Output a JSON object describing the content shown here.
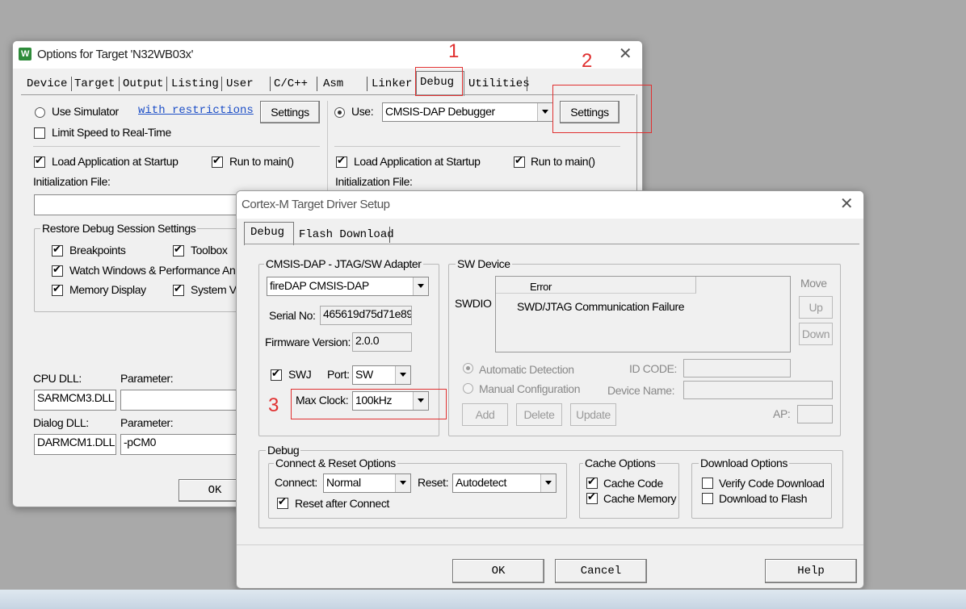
{
  "options_window": {
    "title": "Options for Target 'N32WB03x'",
    "tabs": [
      "Device",
      "Target",
      "Output",
      "Listing",
      "User",
      "C/C++",
      "Asm",
      "Linker",
      "Debug",
      "Utilities"
    ],
    "active_tab": "Debug",
    "use_simulator_label": "Use Simulator",
    "with_restrictions_link": "with restrictions",
    "settings_label": "Settings",
    "limit_speed_label": "Limit Speed to Real-Time",
    "use_label": "Use:",
    "debugger_value": "CMSIS-DAP Debugger",
    "load_app_label": "Load Application at Startup",
    "run_to_main_label": "Run to main()",
    "init_file_label": "Initialization File:",
    "restore_group_title": "Restore Debug Session Settings",
    "breakpoints_label": "Breakpoints",
    "toolbox_label": "Toolbox",
    "watch_windows_label": "Watch Windows & Performance An",
    "memory_display_label": "Memory Display",
    "system_viewer_label": "System Vi",
    "cpu_dll_label": "CPU DLL:",
    "parameter_label": "Parameter:",
    "cpu_dll_value": "SARMCM3.DLL",
    "dialog_dll_label": "Dialog DLL:",
    "dialog_dll_value": "DARMCM1.DLL",
    "dialog_param_value": "-pCM0",
    "ok_label": "OK"
  },
  "driver_window": {
    "title": "Cortex-M Target Driver Setup",
    "tabs": [
      "Debug",
      "Flash Download"
    ],
    "adapter_group_title": "CMSIS-DAP - JTAG/SW Adapter",
    "adapter_value": "fireDAP CMSIS-DAP",
    "serial_label": "Serial No:",
    "serial_value": "465619d75d71e89",
    "firmware_label": "Firmware Version:",
    "firmware_value": "2.0.0",
    "swj_label": "SWJ",
    "port_label": "Port:",
    "port_value": "SW",
    "max_clock_label": "Max Clock:",
    "max_clock_value": "100kHz",
    "sw_device_group_title": "SW Device",
    "swdio_label": "SWDIO",
    "table_header": "Error",
    "table_row": "SWD/JTAG Communication Failure",
    "move_label": "Move",
    "up_label": "Up",
    "down_label": "Down",
    "auto_detect_label": "Automatic Detection",
    "manual_config_label": "Manual Configuration",
    "id_code_label": "ID CODE:",
    "device_name_label": "Device Name:",
    "add_label": "Add",
    "delete_label": "Delete",
    "update_label": "Update",
    "ap_label": "AP:",
    "debug_group_title": "Debug",
    "connect_reset_title": "Connect & Reset Options",
    "connect_label": "Connect:",
    "connect_value": "Normal",
    "reset_label": "Reset:",
    "reset_value": "Autodetect",
    "reset_after_connect_label": "Reset after Connect",
    "cache_options_title": "Cache Options",
    "cache_code_label": "Cache Code",
    "cache_memory_label": "Cache Memory",
    "download_options_title": "Download Options",
    "verify_download_label": "Verify Code Download",
    "download_to_flash_label": "Download to Flash",
    "ok_label": "OK",
    "cancel_label": "Cancel",
    "help_label": "Help"
  },
  "annotations": {
    "one": "1",
    "two": "2",
    "three": "3",
    "color": "#e03030"
  },
  "icons": {
    "app_icon": "keil-uvision-icon",
    "close": "close-icon",
    "dropdown": "chevron-down-icon"
  }
}
